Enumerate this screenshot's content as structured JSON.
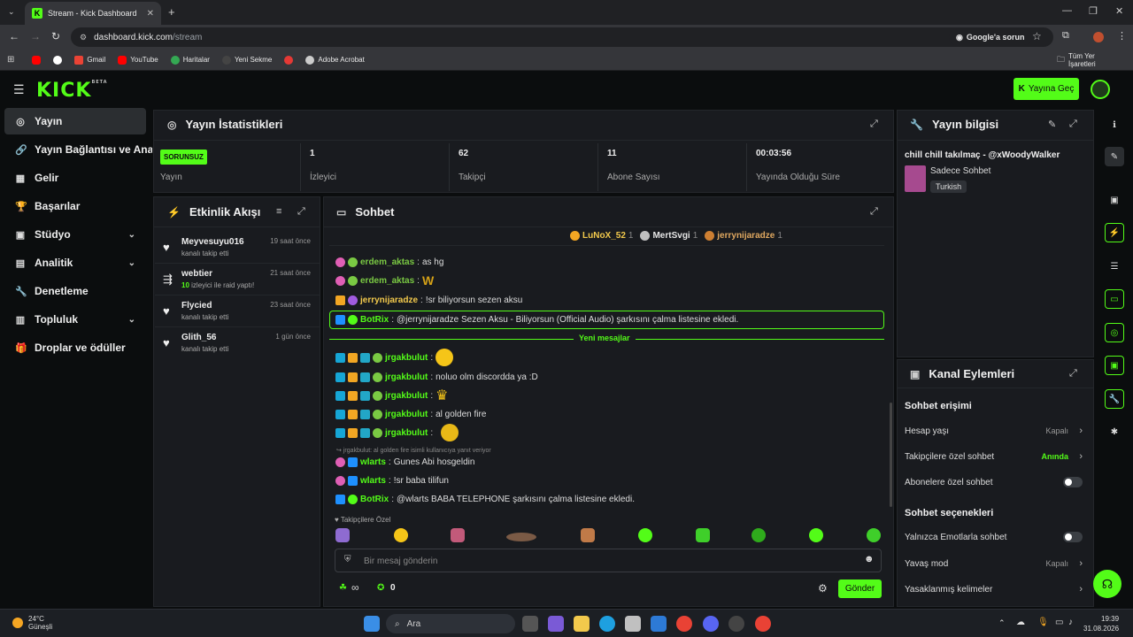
{
  "browser": {
    "tab_title": "Stream - Kick Dashboard",
    "url_host": "dashboard.kick.com",
    "url_path": "/stream",
    "google_issue": "Google'a sorun",
    "bookmarks": [
      "Gmail",
      "YouTube",
      "Haritalar",
      "Yeni Sekme",
      "Adobe Acrobat"
    ],
    "all_bookmarks": "Tüm Yer İşaretleri"
  },
  "header": {
    "logo": "KICK",
    "logo_beta": "BETA",
    "go_live": "Yayına Geç"
  },
  "sidebar": {
    "items": [
      {
        "label": "Yayın",
        "icon": "broadcast-icon"
      },
      {
        "label": "Yayın Bağlantısı ve Anahtarı",
        "icon": "link-icon"
      },
      {
        "label": "Gelir",
        "icon": "revenue-icon"
      },
      {
        "label": "Başarılar",
        "icon": "trophy-icon"
      },
      {
        "label": "Stüdyo",
        "icon": "studio-icon"
      },
      {
        "label": "Analitik",
        "icon": "analytics-icon"
      },
      {
        "label": "Denetleme",
        "icon": "wrench-icon"
      },
      {
        "label": "Topluluk",
        "icon": "community-icon"
      },
      {
        "label": "Droplar ve ödüller",
        "icon": "gift-icon"
      }
    ]
  },
  "stats": {
    "title": "Yayın İstatistikleri",
    "status_badge": "SORUNSUZ",
    "status_label": "Yayın",
    "viewers": "1",
    "viewers_label": "İzleyici",
    "followers": "62",
    "followers_label": "Takipçi",
    "subs": "11",
    "subs_label": "Abone Sayısı",
    "uptime": "00:03:56",
    "uptime_label": "Yayında Olduğu Süre"
  },
  "activity": {
    "title": "Etkinlik Akışı",
    "items": [
      {
        "name": "Meyvesuyu016",
        "time": "19 saat önce",
        "desc": "kanalı takip etti"
      },
      {
        "name": "webtier",
        "time": "21 saat önce",
        "desc_num": "10",
        "desc": "izleyici ile raid yaptı!"
      },
      {
        "name": "Flycied",
        "time": "23 saat önce",
        "desc": "kanalı takip etti"
      },
      {
        "name": "Glith_56",
        "time": "1 gün önce",
        "desc": "kanalı takip etti"
      }
    ]
  },
  "chat": {
    "title": "Sohbet",
    "leaders": [
      {
        "name": "LuNoX_52",
        "count": "1",
        "color": "#f2a623"
      },
      {
        "name": "MertSvgi",
        "count": "1",
        "color": "#c0c0c0"
      },
      {
        "name": "jerrynijaradze",
        "count": "1",
        "color": "#cd7f32"
      }
    ],
    "messages": [
      {
        "user": "erdem_aktas",
        "text": "as hg",
        "color": "#7ac943"
      },
      {
        "user": "erdem_aktas",
        "text": "",
        "color": "#7ac943"
      },
      {
        "user": "jerrynijaradze",
        "text": "!sr biliyorsun sezen aksu",
        "color": "#f2c94c"
      },
      {
        "user": "BotRix",
        "text": "@jerrynijaradze Sezen Aksu - Biliyorsun (Official Audio) şarkısını çalma listesine ekledi.",
        "color": "#53fc18"
      },
      {
        "user": "jrgakbulut",
        "text": "",
        "color": "#53fc18"
      },
      {
        "user": "jrgakbulut",
        "text": "noluo olm discordda ya :D",
        "color": "#53fc18"
      },
      {
        "user": "jrgakbulut",
        "text": "",
        "color": "#53fc18"
      },
      {
        "user": "jrgakbulut",
        "text": "al golden fire",
        "color": "#53fc18"
      },
      {
        "user": "jrgakbulut",
        "text": "",
        "color": "#53fc18"
      },
      {
        "user": "wlarts",
        "text": "Gunes Abi hosgeldin",
        "color": "#53fc18"
      },
      {
        "user": "wlarts",
        "text": "!sr baba tilifun",
        "color": "#53fc18"
      },
      {
        "user": "BotRix",
        "text": "@wlarts BABA TELEPHONE şarkısını çalma listesine ekledi.",
        "color": "#53fc18"
      }
    ],
    "new_messages": "Yeni mesajlar",
    "reply_hint": "jrgakbulut: al golden fire isimli kullanıcıya yanıt veriyor",
    "followers_only_emotes": "Takipçilere Özel",
    "input_placeholder": "Bir mesaj gönderin",
    "points": "0",
    "send": "Gönder"
  },
  "stream_info": {
    "title": "Yayın bilgisi",
    "stream_title": "chill chill takılmaç - @xWoodyWalker",
    "category": "Sadece Sohbet",
    "language": "Turkish"
  },
  "channel_actions": {
    "title": "Kanal Eylemleri",
    "chat_access": "Sohbet erişimi",
    "account_age": "Hesap yaşı",
    "account_age_val": "Kapalı",
    "followers_only": "Takipçilere özel sohbet",
    "followers_only_val": "Anında",
    "subs_only": "Abonelere özel sohbet",
    "chat_options": "Sohbet seçenekleri",
    "emote_only": "Yalnızca Emotlarla sohbet",
    "slow_mode": "Yavaş mod",
    "slow_mode_val": "Kapalı",
    "banned_words": "Yasaklanmış kelimeler"
  },
  "taskbar": {
    "temp": "24°C",
    "weather": "Güneşli",
    "search": "Ara",
    "time": "19:39",
    "date": "31.08.2026"
  },
  "colors": {
    "accent": "#53fc18",
    "panel": "#191b1f",
    "bg": "#0b0d0e"
  }
}
